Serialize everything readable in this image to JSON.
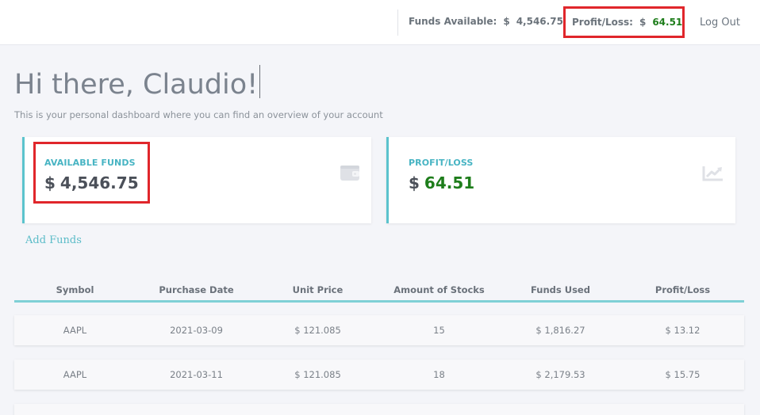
{
  "header": {
    "funds_label": "Funds Available:",
    "funds_currency": "$",
    "funds_value": "4,546.75",
    "profit_label": "Profit/Loss:",
    "profit_currency": "$",
    "profit_value": "64.51",
    "logout_label": "Log Out"
  },
  "greeting": {
    "title": "Hi there, Claudio!",
    "subtitle": "This is your personal dashboard where you can find an overview of your account"
  },
  "cards": {
    "funds": {
      "label": "AVAILABLE FUNDS",
      "currency": "$",
      "value": "4,546.75",
      "icon": "wallet-icon"
    },
    "profit": {
      "label": "PROFIT/LOSS",
      "currency": "$",
      "value": "64.51",
      "icon": "trending-up-icon"
    }
  },
  "add_funds_label": "Add Funds",
  "table": {
    "columns": [
      "Symbol",
      "Purchase Date",
      "Unit Price",
      "Amount of Stocks",
      "Funds Used",
      "Profit/Loss"
    ],
    "rows": [
      [
        "AAPL",
        "2021-03-09",
        "$ 121.085",
        "15",
        "$ 1,816.27",
        "$ 13.12"
      ],
      [
        "AAPL",
        "2021-03-11",
        "$ 121.085",
        "18",
        "$ 2,179.53",
        "$ 15.75"
      ],
      [
        "",
        "",
        "",
        "",
        "",
        ""
      ]
    ]
  },
  "colors": {
    "accent": "#5bc3cd",
    "positive": "#1e7d1b",
    "highlight": "#e0262b"
  }
}
